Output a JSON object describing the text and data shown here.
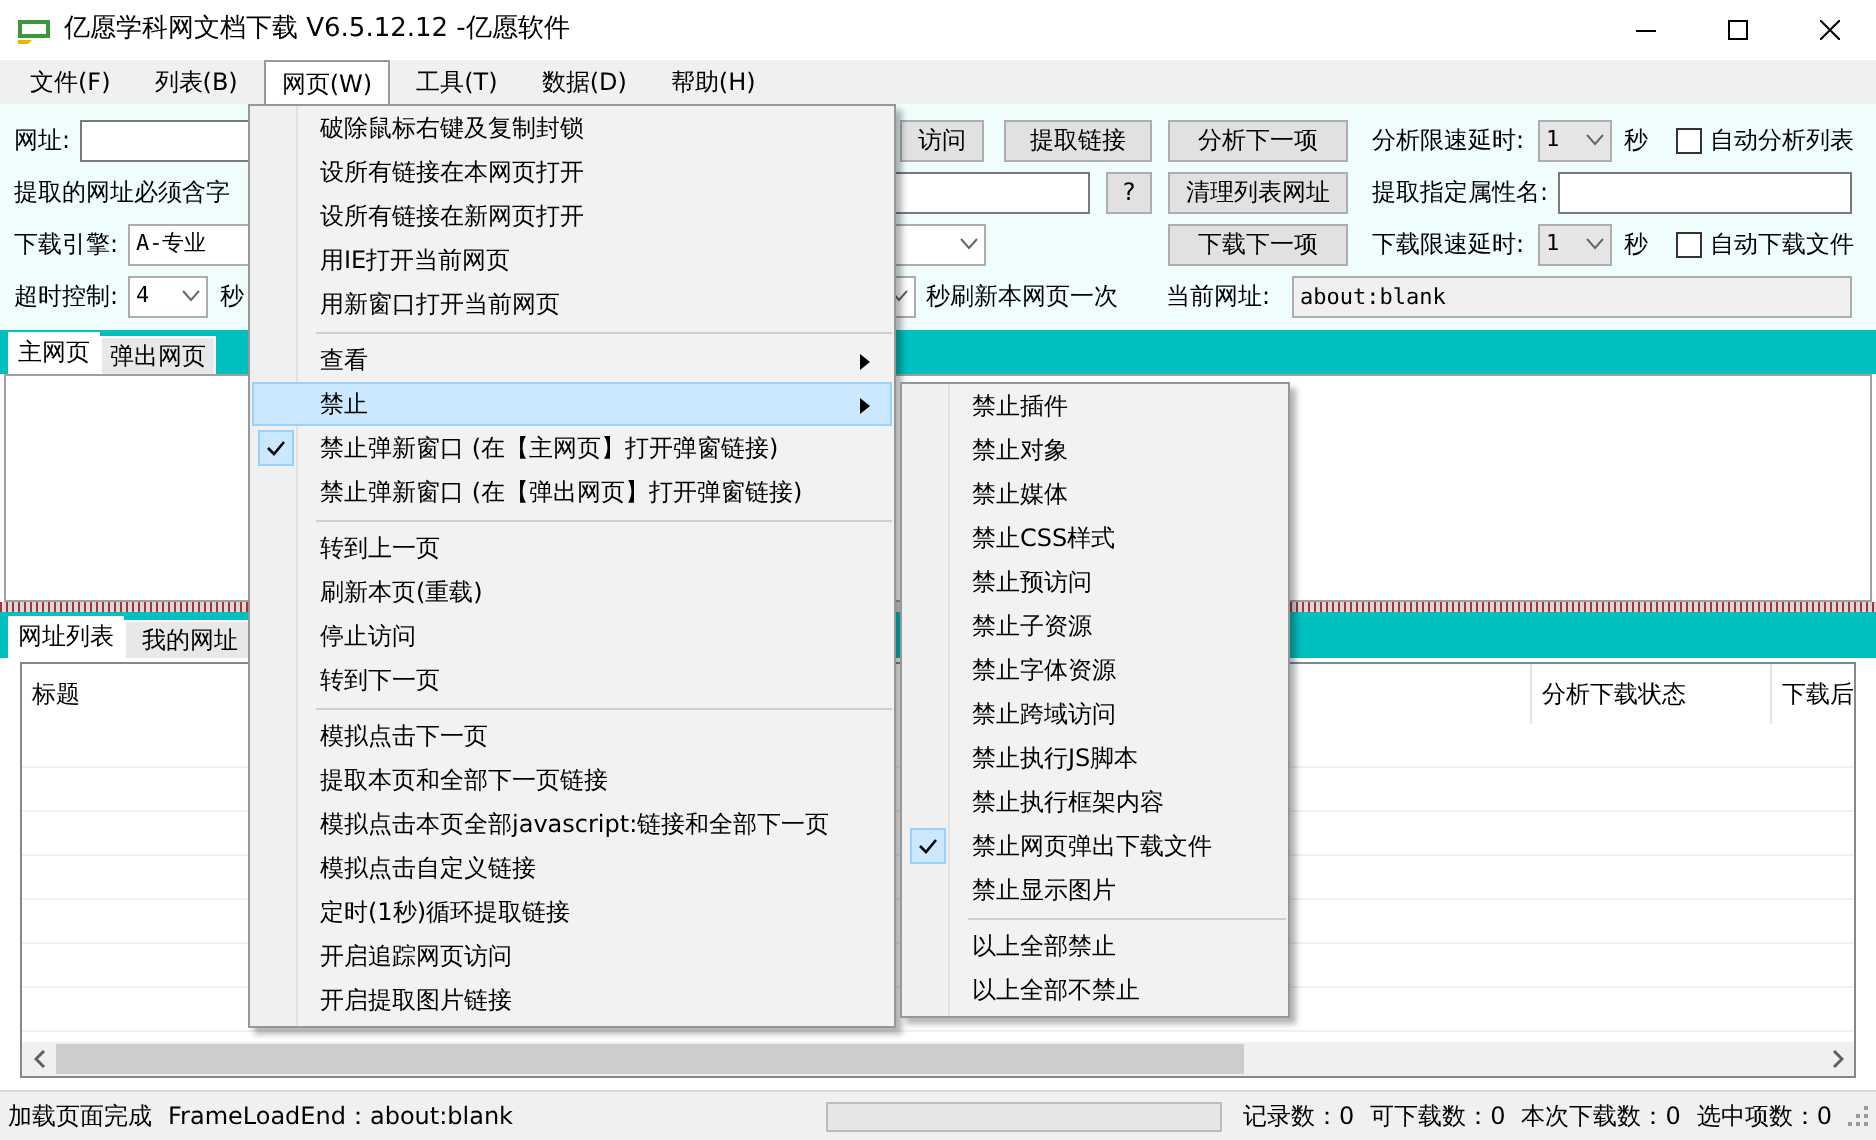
{
  "window": {
    "title": "亿愿学科网文档下载 V6.5.12.12 -亿愿软件"
  },
  "menu_bar": [
    {
      "label": "文件(F)",
      "selected": false
    },
    {
      "label": "列表(B)",
      "selected": false
    },
    {
      "label": "网页(W)",
      "selected": true
    },
    {
      "label": "工具(T)",
      "selected": false
    },
    {
      "label": "数据(D)",
      "selected": false
    },
    {
      "label": "帮助(H)",
      "selected": false
    }
  ],
  "toolbar": [
    [
      {
        "kind": "label",
        "text": "网址:"
      },
      {
        "kind": "input"
      },
      {
        "kind": "button",
        "label": "访问"
      },
      {
        "kind": "button",
        "label": "提取链接"
      },
      {
        "kind": "button",
        "label": "分析下一项"
      },
      {
        "kind": "label",
        "text": "分析限速延时:"
      },
      {
        "kind": "select",
        "value": "1"
      },
      {
        "kind": "label",
        "text": "秒"
      },
      {
        "kind": "checkbox",
        "label": "自动分析列表",
        "checked": false
      }
    ],
    [
      {
        "kind": "label",
        "text": "提取的网址必须含字"
      },
      {
        "kind": "input"
      },
      {
        "kind": "button",
        "label": "?"
      },
      {
        "kind": "button",
        "label": "清理列表网址"
      },
      {
        "kind": "label",
        "text": "提取指定属性名:"
      },
      {
        "kind": "input"
      }
    ],
    [
      {
        "kind": "label",
        "text": "下载引擎:"
      },
      {
        "kind": "select",
        "value": "A-专业"
      },
      {
        "kind": "button",
        "label": "下载下一项"
      },
      {
        "kind": "label",
        "text": "下载限速延时:"
      },
      {
        "kind": "select",
        "value": "1"
      },
      {
        "kind": "label",
        "text": "秒"
      },
      {
        "kind": "checkbox",
        "label": "自动下载文件",
        "checked": false
      }
    ],
    [
      {
        "kind": "label",
        "text": "超时控制:"
      },
      {
        "kind": "select",
        "value": "4"
      },
      {
        "kind": "label",
        "text": "秒"
      },
      {
        "kind": "select"
      },
      {
        "kind": "label",
        "text": "秒刷新本网页一次"
      },
      {
        "kind": "label",
        "text": "当前网址:"
      },
      {
        "kind": "input",
        "value": "about:blank"
      }
    ]
  ],
  "top_tabs": [
    {
      "label": "主网页",
      "selected": true
    },
    {
      "label": "弹出网页",
      "selected": false
    }
  ],
  "bottom_tabs": [
    {
      "label": "网址列表",
      "selected": true
    },
    {
      "label": "我的网址",
      "selected": false
    }
  ],
  "list": {
    "columns": [
      "标题",
      "分析下载状态",
      "下载后"
    ]
  },
  "open_menu": {
    "items": [
      {
        "kind": "item",
        "label": "破除鼠标右键及复制封锁",
        "checked": false,
        "selected": false
      },
      {
        "kind": "item",
        "label": "设所有链接在本网页打开",
        "checked": false,
        "selected": false
      },
      {
        "kind": "item",
        "label": "设所有链接在新网页打开",
        "checked": false,
        "selected": false
      },
      {
        "kind": "item",
        "label": "用IE打开当前网页",
        "checked": false,
        "selected": false
      },
      {
        "kind": "item",
        "label": "用新窗口打开当前网页",
        "checked": false,
        "selected": false
      },
      {
        "kind": "separator"
      },
      {
        "kind": "submenu",
        "label": "查看",
        "checked": false,
        "selected": false
      },
      {
        "kind": "submenu",
        "label": "禁止",
        "checked": false,
        "selected": true
      },
      {
        "kind": "item",
        "label": "禁止弹新窗口 (在【主网页】打开弹窗链接)",
        "checked": true,
        "selected": false
      },
      {
        "kind": "item",
        "label": "禁止弹新窗口 (在【弹出网页】打开弹窗链接)",
        "checked": false,
        "selected": false
      },
      {
        "kind": "separator"
      },
      {
        "kind": "item",
        "label": "转到上一页",
        "checked": false,
        "selected": false
      },
      {
        "kind": "item",
        "label": "刷新本页(重载)",
        "checked": false,
        "selected": false
      },
      {
        "kind": "item",
        "label": "停止访问",
        "checked": false,
        "selected": false
      },
      {
        "kind": "item",
        "label": "转到下一页",
        "checked": false,
        "selected": false
      },
      {
        "kind": "separator"
      },
      {
        "kind": "item",
        "label": "模拟点击下一页",
        "checked": false,
        "selected": false
      },
      {
        "kind": "item",
        "label": "提取本页和全部下一页链接",
        "checked": false,
        "selected": false
      },
      {
        "kind": "item",
        "label": "模拟点击本页全部javascript:链接和全部下一页",
        "checked": false,
        "selected": false
      },
      {
        "kind": "item",
        "label": "模拟点击自定义链接",
        "checked": false,
        "selected": false
      },
      {
        "kind": "item",
        "label": "定时(1秒)循环提取链接",
        "checked": false,
        "selected": false
      },
      {
        "kind": "item",
        "label": "开启追踪网页访问",
        "checked": false,
        "selected": false
      },
      {
        "kind": "item",
        "label": "开启提取图片链接",
        "checked": false,
        "selected": false
      }
    ]
  },
  "submenu": {
    "items": [
      {
        "kind": "item",
        "label": "禁止插件",
        "checked": false
      },
      {
        "kind": "item",
        "label": "禁止对象",
        "checked": false
      },
      {
        "kind": "item",
        "label": "禁止媒体",
        "checked": false
      },
      {
        "kind": "item",
        "label": "禁止CSS样式",
        "checked": false
      },
      {
        "kind": "item",
        "label": "禁止预访问",
        "checked": false
      },
      {
        "kind": "item",
        "label": "禁止子资源",
        "checked": false
      },
      {
        "kind": "item",
        "label": "禁止字体资源",
        "checked": false
      },
      {
        "kind": "item",
        "label": "禁止跨域访问",
        "checked": false
      },
      {
        "kind": "item",
        "label": "禁止执行JS脚本",
        "checked": false
      },
      {
        "kind": "item",
        "label": "禁止执行框架内容",
        "checked": false
      },
      {
        "kind": "item",
        "label": "禁止网页弹出下载文件",
        "checked": true
      },
      {
        "kind": "item",
        "label": "禁止显示图片",
        "checked": false
      },
      {
        "kind": "separator"
      },
      {
        "kind": "item",
        "label": "以上全部禁止",
        "checked": false
      },
      {
        "kind": "item",
        "label": "以上全部不禁止",
        "checked": false
      }
    ]
  },
  "status_bar": {
    "messages": [
      "加载页面完成",
      "FrameLoadEnd：about:blank"
    ],
    "progress": {
      "level": 0
    },
    "counters": [
      "记录数：0",
      "可下载数：0",
      "本次下载数：0",
      "选中项数：0"
    ]
  }
}
